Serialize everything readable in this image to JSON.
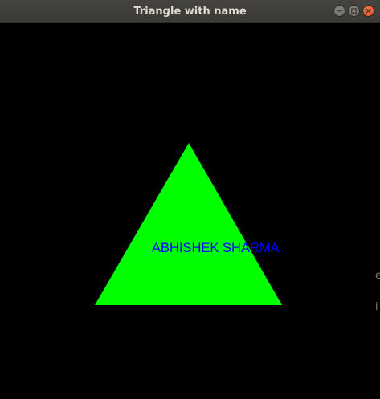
{
  "window": {
    "title": "Triangle with name",
    "controls": {
      "minimize": "minimize-icon",
      "maximize": "maximize-icon",
      "close": "close-icon"
    }
  },
  "canvas": {
    "background": "#000000",
    "triangle": {
      "fill": "#00ff00"
    },
    "label": {
      "text": "ABHISHEK SHARMA",
      "color": "#0000ff"
    }
  }
}
